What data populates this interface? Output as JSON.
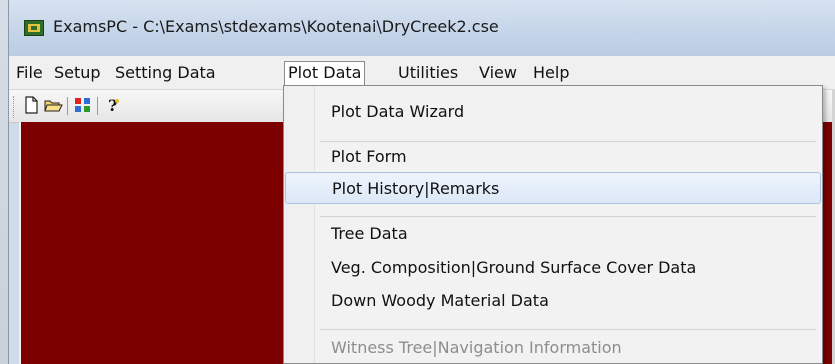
{
  "window": {
    "title": "ExamsPC - C:\\Exams\\stdexams\\Kootenai\\DryCreek2.cse",
    "client_color": "#7d0000"
  },
  "menubar": {
    "items": [
      "File",
      "Setup",
      "Setting Data",
      "Plot Data",
      "Utilities",
      "View",
      "Help"
    ],
    "active": "Plot Data"
  },
  "toolbar": {
    "icons": [
      "new-document-icon",
      "open-folder-icon",
      "transfer-data-icon",
      "help-icon"
    ]
  },
  "plot_data_menu": {
    "items": [
      {
        "label": "Plot Data Wizard",
        "state": "normal"
      },
      {
        "label": "Plot Form",
        "state": "normal"
      },
      {
        "label": "Plot History|Remarks",
        "state": "hover"
      },
      {
        "label": "Tree Data",
        "state": "normal"
      },
      {
        "label": "Veg. Composition|Ground Surface Cover Data",
        "state": "normal"
      },
      {
        "label": "Down Woody Material Data",
        "state": "normal"
      },
      {
        "label": "Witness Tree|Navigation Information",
        "state": "disabled"
      }
    ]
  }
}
